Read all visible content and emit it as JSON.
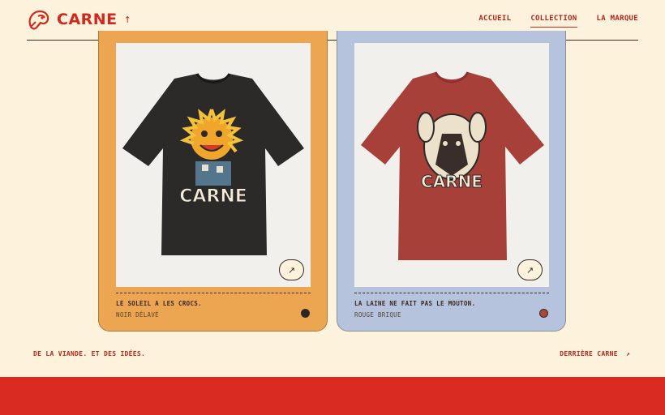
{
  "brand": {
    "name": "CARNE",
    "arrow": "↑"
  },
  "nav": {
    "items": [
      {
        "label": "ACCUEIL"
      },
      {
        "label": "COLLECTION"
      },
      {
        "label": "LA MARQUE"
      }
    ]
  },
  "products": [
    {
      "name": "LE SOLEIL A LES CROCS.",
      "color_name": "NOIR DÉLAVÉ",
      "swatch": "#2a2724",
      "card_color": "#eca551",
      "shirt_color": "#2b2a28",
      "print_text": "CARNE",
      "open_icon": "arrow-up-right-icon"
    },
    {
      "name": "LA LAINE NE FAIT PAS LE MOUTON.",
      "color_name": "ROUGE BRIQUE",
      "swatch": "#a9473e",
      "card_color": "#b5c3dc",
      "shirt_color": "#a8403a",
      "print_text": "CARNE",
      "open_icon": "arrow-up-right-icon"
    }
  ],
  "footer": {
    "tagline": "DE LA VIANDE. ET DES IDÉES.",
    "behind_label": "DERRIÈRE CARNE",
    "behind_arrow": "↗"
  },
  "colors": {
    "accent": "#d1291f",
    "background": "#fdf3dc",
    "footer": "#d92b21"
  }
}
